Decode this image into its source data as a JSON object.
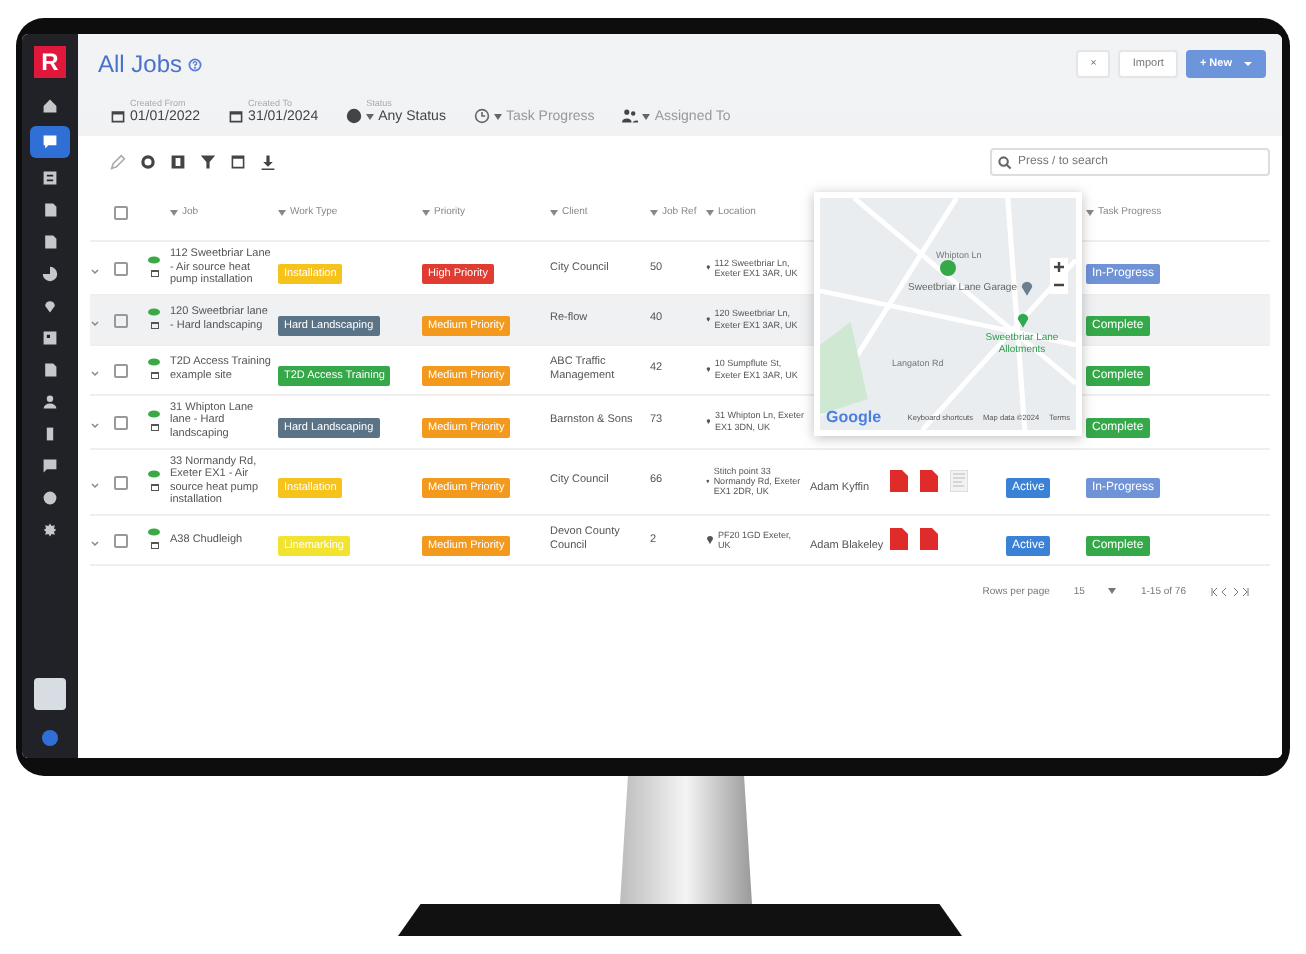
{
  "sidebar": {
    "logo": "R",
    "items": [
      {
        "kind": "home",
        "selected": false
      },
      {
        "kind": "chat",
        "selected": true
      },
      {
        "kind": "list",
        "selected": false
      },
      {
        "kind": "document",
        "selected": false
      },
      {
        "kind": "document",
        "selected": false
      },
      {
        "kind": "chart",
        "selected": false
      },
      {
        "kind": "pin",
        "selected": false
      },
      {
        "kind": "grid",
        "selected": false
      },
      {
        "kind": "document",
        "selected": false
      },
      {
        "kind": "user",
        "selected": false
      },
      {
        "kind": "phone",
        "selected": false
      },
      {
        "kind": "message",
        "selected": false
      },
      {
        "kind": "help",
        "selected": false
      },
      {
        "kind": "gear",
        "selected": false
      }
    ]
  },
  "page": {
    "title": "All Jobs",
    "actions": [
      {
        "label": "×",
        "kind": "plain"
      },
      {
        "label": "Import",
        "kind": "plain"
      },
      {
        "label": "+ New",
        "kind": "primary"
      }
    ]
  },
  "filters": [
    {
      "caption": "Created From",
      "value": "01/01/2022",
      "kind": "calendar"
    },
    {
      "caption": "Created To",
      "value": "31/01/2024",
      "kind": "calendar"
    },
    {
      "caption": "Status",
      "value": "Any Status",
      "kind": "status"
    },
    {
      "value": "Task Progress",
      "kind": "clock"
    },
    {
      "value": "Assigned To",
      "kind": "people"
    }
  ],
  "search": {
    "placeholder": "Press / to search"
  },
  "table": {
    "select_all": {
      "checked": false
    },
    "columns": [
      "Job",
      "Work Type",
      "Priority",
      "Client",
      "Job Ref",
      "Location",
      "Task Progress"
    ],
    "rows": [
      {
        "selected": false,
        "job": "112 Sweetbriar Lane - Air source heat pump installation",
        "work_type": {
          "label": "Installation",
          "color": "#f6c21c"
        },
        "priority": {
          "label": "High Priority",
          "color": "#e03c31"
        },
        "client": "City Council",
        "ref": "50",
        "location": "112 Sweetbriar Ln, Exeter EX1 3AR, UK",
        "progress": {
          "label": "In-Progress",
          "color": "#6f93d6"
        }
      },
      {
        "selected": true,
        "job": "120 Sweetbriar lane - Hard landscaping",
        "work_type": {
          "label": "Hard Landscaping",
          "color": "#5b7386"
        },
        "priority": {
          "label": "Medium Priority",
          "color": "#f39a1e"
        },
        "client": "Re-flow",
        "ref": "40",
        "location": "120 Sweetbriar Ln, Exeter EX1 3AR, UK",
        "progress": {
          "label": "Complete",
          "color": "#35a84a"
        }
      },
      {
        "selected": false,
        "job": "T2D Access Training example site",
        "work_type": {
          "label": "T2D Access Training",
          "color": "#35a84a"
        },
        "priority": {
          "label": "Medium Priority",
          "color": "#f39a1e"
        },
        "client": "ABC Traffic Management",
        "ref": "42",
        "location": "10 Sumpflute St, Exeter EX1 3AR, UK",
        "progress": {
          "label": "Complete",
          "color": "#35a84a"
        }
      },
      {
        "selected": false,
        "job": "31 Whipton Lane lane - Hard landscaping",
        "work_type": {
          "label": "Hard Landscaping",
          "color": "#5b7386"
        },
        "priority": {
          "label": "Medium Priority",
          "color": "#f39a1e"
        },
        "client": "Barnston & Sons",
        "ref": "73",
        "location": "31 Whipton Ln, Exeter EX1 3DN, UK",
        "progress": {
          "label": "Complete",
          "color": "#35a84a"
        }
      },
      {
        "selected": false,
        "job": "33 Normandy Rd, Exeter EX1 - Air source heat pump installation",
        "work_type": {
          "label": "Installation",
          "color": "#f6c21c"
        },
        "priority": {
          "label": "Medium Priority",
          "color": "#f39a1e"
        },
        "client": "City Council",
        "ref": "66",
        "location": "Stitch point 33 Normandy Rd, Exeter EX1 2DR, UK",
        "assigned": "Adam Kyffin",
        "attachments": [
          {
            "kind": "pdf"
          },
          {
            "kind": "pdf"
          },
          {
            "kind": "doc"
          }
        ],
        "status": {
          "label": "Active",
          "color": "#3b82d6"
        },
        "progress": {
          "label": "In-Progress",
          "color": "#6f93d6"
        }
      },
      {
        "selected": false,
        "job": "A38 Chudleigh",
        "work_type": {
          "label": "Linemarking",
          "color": "#f2e330"
        },
        "priority": {
          "label": "Medium Priority",
          "color": "#f39a1e"
        },
        "client": "Devon County Council",
        "ref": "2",
        "location": "PF20 1GD Exeter, UK",
        "assigned": "Adam Blakeley",
        "attachments": [
          {
            "kind": "pdf"
          },
          {
            "kind": "pdf"
          }
        ],
        "status": {
          "label": "Active",
          "color": "#3b82d6"
        },
        "progress": {
          "label": "Complete",
          "color": "#35a84a"
        }
      }
    ]
  },
  "map": {
    "places": [
      {
        "label": "Sweetbriar Lane Garage",
        "kind": "garage"
      },
      {
        "label": "Sweetbriar Lane Allotments",
        "kind": "park"
      }
    ],
    "streets": [
      "Whipton Ln",
      "Langaton Rd"
    ],
    "attribution": "Google",
    "footer": [
      "Keyboard shortcuts",
      "Map data ©2024",
      "Terms"
    ]
  },
  "pagination": {
    "rows_label": "Rows per page",
    "rows_value": "15",
    "range": "1-15 of 76"
  }
}
